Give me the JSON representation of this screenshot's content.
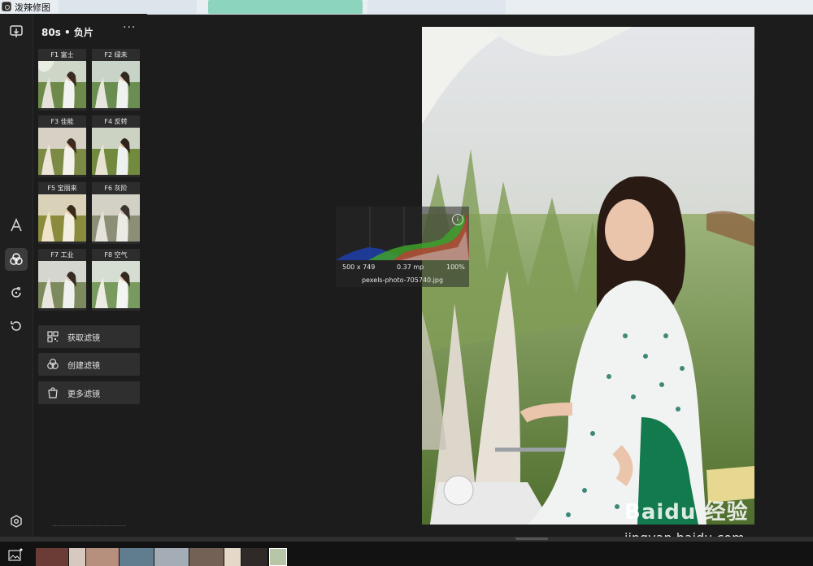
{
  "window": {
    "title": "泼辣修图"
  },
  "rail": {
    "items": [
      {
        "name": "export-icon"
      },
      {
        "name": "text-icon"
      },
      {
        "name": "filters-icon",
        "active": true
      },
      {
        "name": "redo-icon"
      },
      {
        "name": "undo-icon"
      },
      {
        "name": "settings-icon"
      }
    ]
  },
  "panel": {
    "title": "80s • 负片",
    "more": "···",
    "filters": [
      {
        "label": "F1 富士"
      },
      {
        "label": "F2 绿未"
      },
      {
        "label": "F3 佳能"
      },
      {
        "label": "F4 反转"
      },
      {
        "label": "F5 宝丽来"
      },
      {
        "label": "F6 灰阶"
      },
      {
        "label": "F7 工业"
      },
      {
        "label": "F8 空气"
      }
    ],
    "buttons": [
      {
        "label": "获取滤镜",
        "icon": "qr-code-icon"
      },
      {
        "label": "创建滤镜",
        "icon": "filters-icon"
      },
      {
        "label": "更多滤镜",
        "icon": "shopping-bag-icon"
      }
    ]
  },
  "histogram": {
    "dimensions": "500 x 749",
    "megapixels": "0.37 mp",
    "zoom": "100%",
    "filename": "pexels-photo-705740.jpg",
    "info_icon": "info-icon"
  },
  "watermark": {
    "brand": "Baidu 经验",
    "url": "jingyan.baidu.com"
  },
  "colors": {
    "accent": "#3c3c3c",
    "background": "#1c1c1c"
  }
}
